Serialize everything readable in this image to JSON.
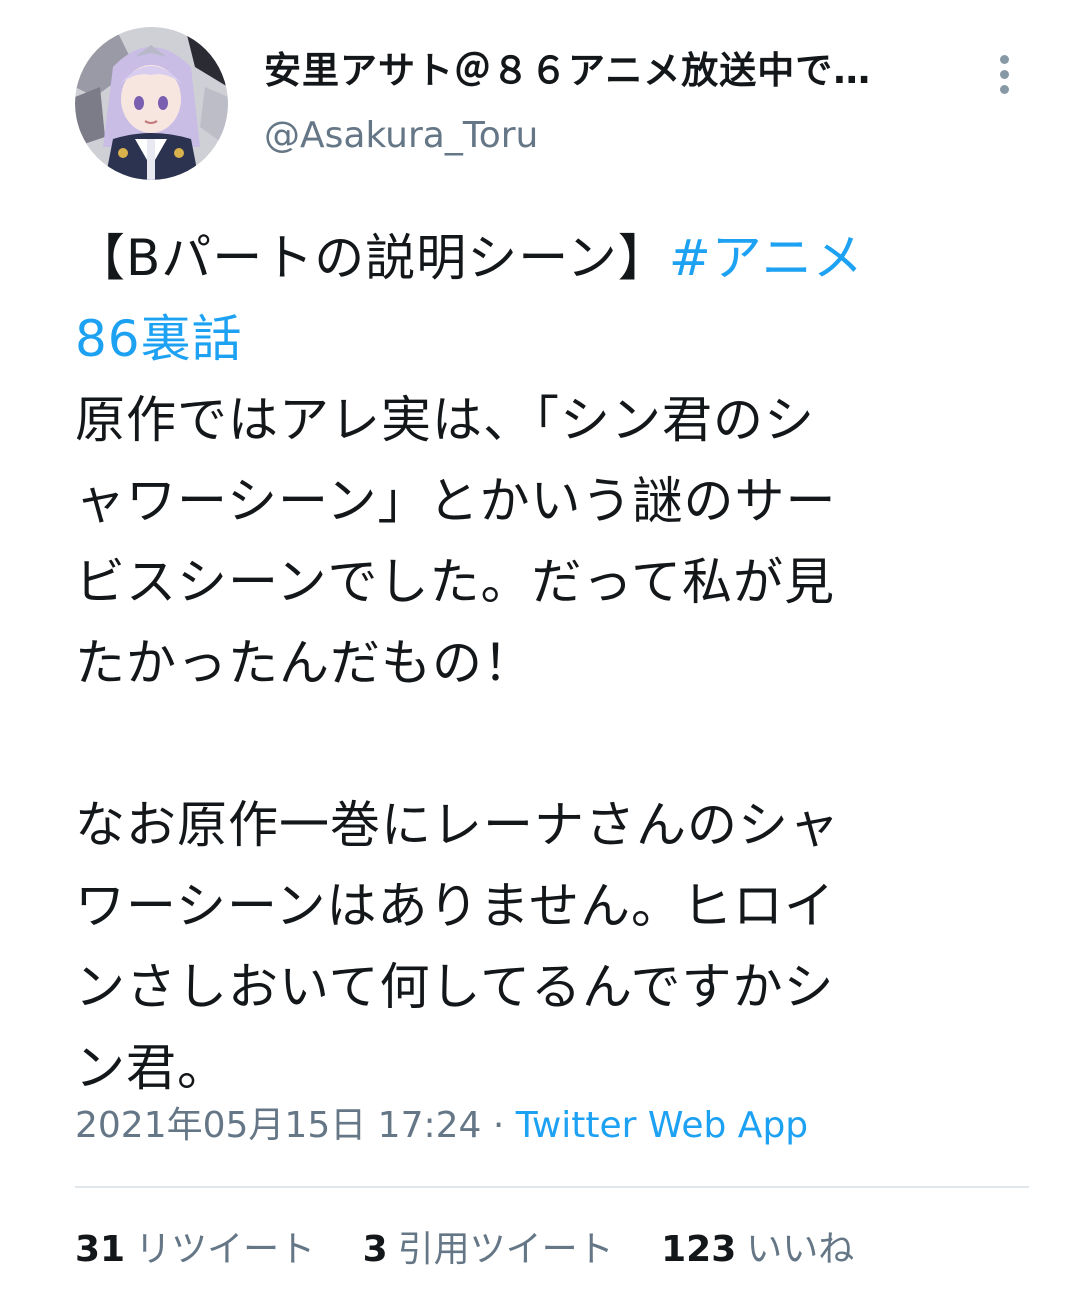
{
  "user": {
    "display_name": "安里アサト＠８６アニメ放送中で…",
    "handle": "@Asakura_Toru",
    "avatar_icon": "anime-girl-avatar"
  },
  "more_icon": "vertical-ellipsis-icon",
  "tweet": {
    "line1_text": "【Bパートの説明シーン】",
    "hashtag_part1": "#アニメ",
    "hashtag_part2": "86裏話",
    "lines": [
      "原作ではアレ実は、「シン君のシ",
      "ャワーシーン」とかいう謎のサー",
      "ビスシーンでした。だって私が見",
      "たかったんだもの！"
    ],
    "lines2": [
      "なお原作一巻にレーナさんのシャ",
      "ワーシーンはありません。ヒロイ",
      "ンさしおいて何してるんですかシ",
      "ン君。"
    ]
  },
  "meta": {
    "timestamp": "2021年05月15日 17:24",
    "separator": " · ",
    "source": "Twitter Web App"
  },
  "stats": {
    "retweets_count": "31",
    "retweets_label": "リツイート",
    "quotes_count": "3",
    "quotes_label": "引用ツイート",
    "likes_count": "123",
    "likes_label": "いいね"
  },
  "colors": {
    "link": "#1da1f2",
    "secondary_text": "#657786",
    "primary_text": "#14171a",
    "divider": "#e1e8ed"
  }
}
